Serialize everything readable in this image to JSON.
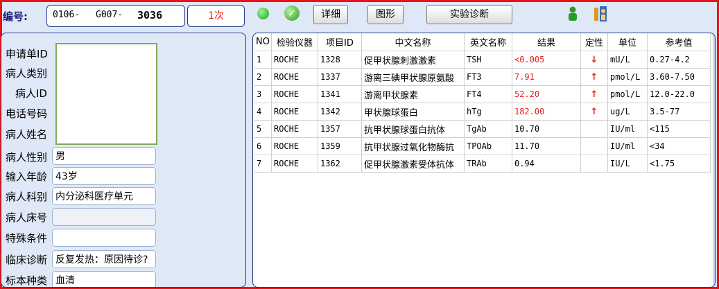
{
  "header": {
    "id_label": "编号:",
    "id_part1": "0106-",
    "id_part2": "G007-",
    "id_part3": "3036",
    "count": "1次",
    "buttons": {
      "detail": "详细",
      "chart": "图形",
      "diagnosis": "实验诊断"
    }
  },
  "patient": {
    "fields": [
      {
        "label": "申请单ID",
        "value": ""
      },
      {
        "label": "病人类别",
        "value": ""
      },
      {
        "label": "病人ID",
        "value": ""
      },
      {
        "label": "电话号码",
        "value": ""
      },
      {
        "label": "病人姓名",
        "value": ""
      },
      {
        "label": "病人性别",
        "value": "男"
      },
      {
        "label": "输入年龄",
        "value": "43岁"
      },
      {
        "label": "病人科别",
        "value": "内分泌科医疗单元"
      },
      {
        "label": "病人床号",
        "value": ""
      },
      {
        "label": "特殊条件",
        "value": ""
      },
      {
        "label": "临床诊断",
        "value": "反复发热：原因待诊?"
      },
      {
        "label": "标本种类",
        "value": "血清"
      }
    ]
  },
  "results": {
    "columns": [
      "NO",
      "检验仪器",
      "项目ID",
      "中文名称",
      "英文名称",
      "结果",
      "定性",
      "单位",
      "参考值"
    ],
    "rows": [
      {
        "no": "1",
        "instrument": "ROCHE",
        "item_id": "1328",
        "cn": "促甲状腺刺激激素",
        "en": "TSH",
        "result": "<0.005",
        "flag": "↓",
        "unit": "mU/L",
        "ref": "0.27-4.2",
        "abnormal": true
      },
      {
        "no": "2",
        "instrument": "ROCHE",
        "item_id": "1337",
        "cn": "游离三碘甲状腺原氨酸",
        "en": "FT3",
        "result": "7.91",
        "flag": "↑",
        "unit": "pmol/L",
        "ref": "3.60-7.50",
        "abnormal": true
      },
      {
        "no": "3",
        "instrument": "ROCHE",
        "item_id": "1341",
        "cn": "游离甲状腺素",
        "en": "FT4",
        "result": "52.20",
        "flag": "↑",
        "unit": "pmol/L",
        "ref": "12.0-22.0",
        "abnormal": true
      },
      {
        "no": "4",
        "instrument": "ROCHE",
        "item_id": "1342",
        "cn": "甲状腺球蛋白",
        "en": "hTg",
        "result": "182.00",
        "flag": "↑",
        "unit": "ug/L",
        "ref": "3.5-77",
        "abnormal": true
      },
      {
        "no": "5",
        "instrument": "ROCHE",
        "item_id": "1357",
        "cn": "抗甲状腺球蛋白抗体",
        "en": "TgAb",
        "result": "10.70",
        "flag": "",
        "unit": "IU/ml",
        "ref": "<115",
        "abnormal": false
      },
      {
        "no": "6",
        "instrument": "ROCHE",
        "item_id": "1359",
        "cn": "抗甲状腺过氧化物酶抗",
        "en": "TPOAb",
        "result": "11.70",
        "flag": "",
        "unit": "IU/ml",
        "ref": "<34",
        "abnormal": false
      },
      {
        "no": "7",
        "instrument": "ROCHE",
        "item_id": "1362",
        "cn": "促甲状腺激素受体抗体",
        "en": "TRAb",
        "result": "0.94",
        "flag": "",
        "unit": "IU/L",
        "ref": "<1.75",
        "abnormal": false
      }
    ]
  },
  "colors": {
    "frame": "#ee1111",
    "abnormal": "#e02020",
    "panel_border": "#1e3a8c",
    "panel_bg": "#dfe8f6"
  },
  "icons": [
    "green-dot-icon",
    "green-check-icon",
    "user-icon",
    "users-tools-icon"
  ]
}
